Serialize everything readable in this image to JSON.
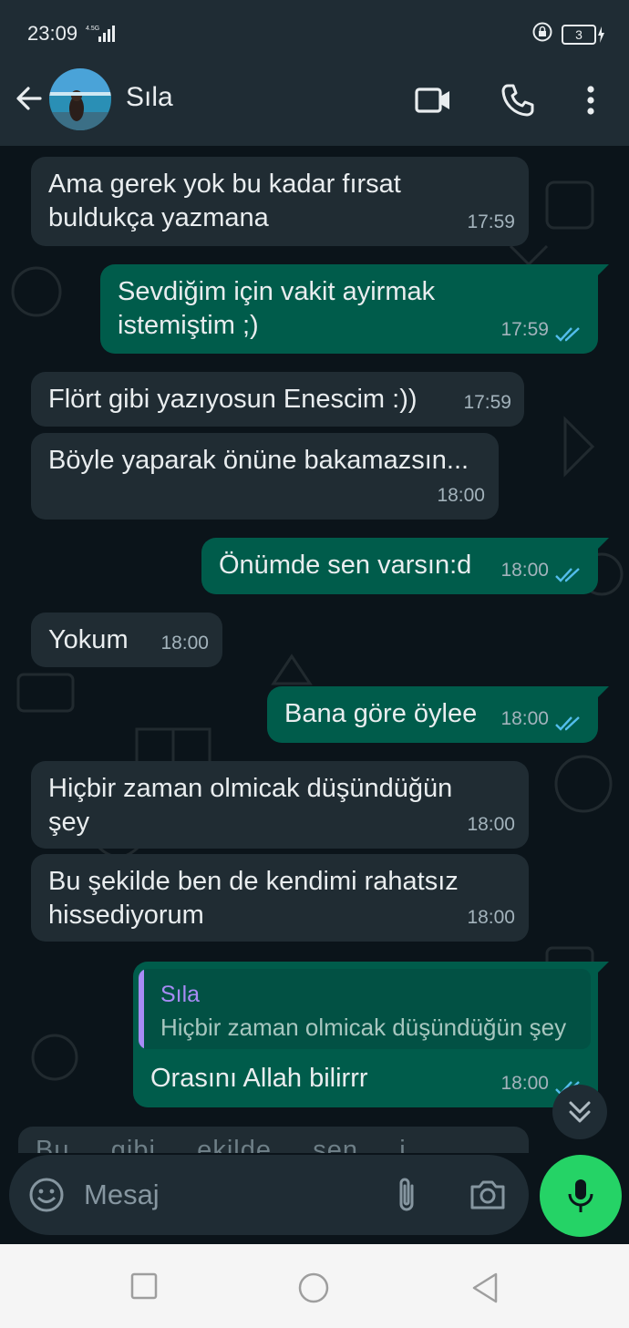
{
  "status_bar": {
    "time": "23:09",
    "network": "4.5G",
    "battery": "3"
  },
  "header": {
    "contact_name": "Sıla"
  },
  "messages": [
    {
      "dir": "in",
      "lines": [
        "Ama gerek yok bu kadar fırsat",
        "buldukça yazmana"
      ],
      "time": "17:59"
    },
    {
      "dir": "out",
      "lines": [
        "Sevdiğim için vakit ayirmak",
        "istemiştim ;)"
      ],
      "time": "17:59",
      "read": true
    },
    {
      "dir": "in",
      "lines": [
        "Flört gibi yazıyosun Enescim :))"
      ],
      "time": "17:59"
    },
    {
      "dir": "in",
      "lines": [
        "Böyle yaparak önüne bakamazsın..."
      ],
      "time": "18:00"
    },
    {
      "dir": "out",
      "lines": [
        "Önümde sen varsın:d"
      ],
      "time": "18:00",
      "read": true
    },
    {
      "dir": "in",
      "lines": [
        "Yokum"
      ],
      "time": "18:00"
    },
    {
      "dir": "out",
      "lines": [
        "Bana göre öylee"
      ],
      "time": "18:00",
      "read": true
    },
    {
      "dir": "in",
      "lines": [
        "Hiçbir zaman olmicak düşündüğün",
        "şey"
      ],
      "time": "18:00"
    },
    {
      "dir": "in",
      "lines": [
        "Bu şekilde ben de kendimi rahatsız",
        "hissediyorum"
      ],
      "time": "18:00"
    },
    {
      "dir": "out",
      "lines": [
        "Orasını Allah bilirrr"
      ],
      "time": "18:00",
      "read": true,
      "quote": {
        "author": "Sıla",
        "text": "Hiçbir zaman olmicak düşündüğün şey"
      }
    },
    {
      "dir": "in",
      "lines": [
        "Bu ... gibi ... ekilde ... sen ... i"
      ],
      "time": "",
      "partial": true
    }
  ],
  "composer": {
    "placeholder": "Mesaj"
  },
  "colors": {
    "incoming": "#202c33",
    "outgoing": "#005c4b",
    "accent": "#25d366",
    "read_ticks": "#53bdeb"
  },
  "icons": {
    "back": "arrow-left-icon",
    "video": "video-call-icon",
    "call": "phone-icon",
    "menu": "more-vert-icon",
    "emoji": "emoji-icon",
    "attach": "paperclip-icon",
    "camera": "camera-icon",
    "mic": "mic-icon",
    "scroll": "double-chevron-down-icon"
  }
}
